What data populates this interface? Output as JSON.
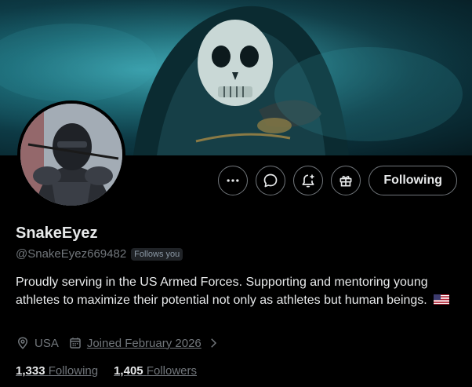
{
  "profile": {
    "display_name": "SnakeEyez",
    "handle": "@SnakeEyez669482",
    "follows_you_badge": "Follows you",
    "bio": "Proudly serving in the US Armed Forces. Supporting and mentoring young athletes to maximize their potential not only as athletes but human beings.",
    "bio_emoji": "us-flag-icon"
  },
  "actions": {
    "more_icon": "more-icon",
    "message_icon": "message-icon",
    "notify_icon": "notification-add-icon",
    "gift_icon": "gift-icon",
    "follow_label": "Following"
  },
  "meta": {
    "location": "USA",
    "location_icon": "location-icon",
    "joined": "Joined February 2026",
    "joined_icon": "calendar-icon",
    "chevron_icon": "chevron-right-icon"
  },
  "stats": {
    "following_count": "1,333",
    "following_label": "Following",
    "followers_count": "1,405",
    "followers_label": "Followers"
  },
  "colors": {
    "background": "#000000",
    "text_primary": "#e7e9ea",
    "text_secondary": "#71767b",
    "border": "#71767b",
    "banner_teal": "#2a8e9c"
  }
}
